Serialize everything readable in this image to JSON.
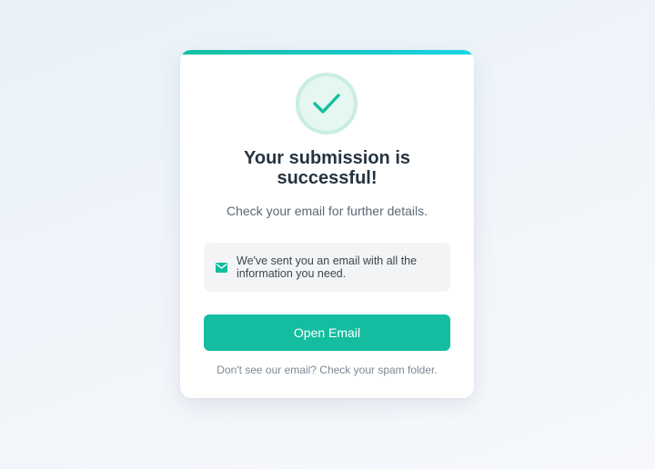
{
  "card": {
    "title": "Your submission is successful!",
    "subtitle": "Check your email for further details.",
    "notice": {
      "icon": "mail-icon",
      "text": "We've sent you an email with all the information you need."
    },
    "primary_button": {
      "label": "Open Email"
    },
    "footer": "Don't see our email? Check your spam folder."
  },
  "status_icon": "checkmark-icon",
  "colors": {
    "accent": "#14bd9f",
    "accent_light": "#e6f6f0",
    "title_text": "#263440",
    "muted_text": "#7c8894"
  }
}
